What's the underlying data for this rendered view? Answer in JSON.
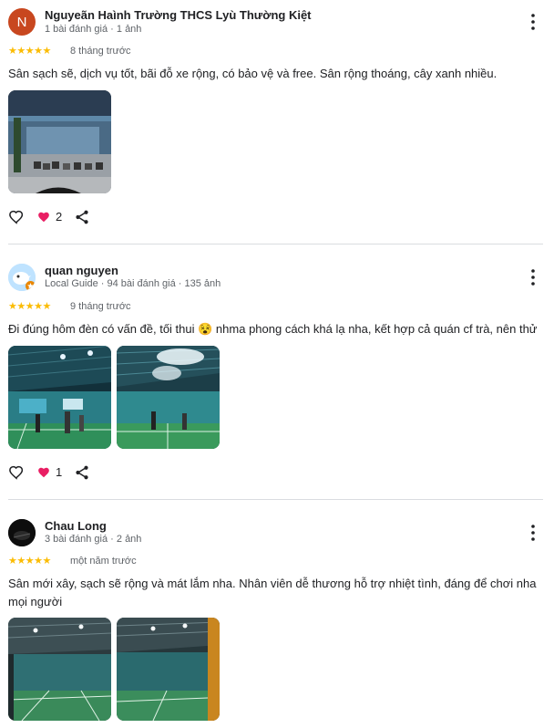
{
  "reviews": [
    {
      "author": "Nguyeãn Haình Trường THCS Lyù Thường Kiệt",
      "avatar_letter": "N",
      "meta": "1 bài đánh giá · 1 ảnh",
      "rating": "★★★★★",
      "time": "8 tháng trước",
      "text": "Sân sạch sẽ, dịch vụ tốt, bãi đỗ xe rộng, có bảo vệ và free. Sân rộng thoáng, cây xanh nhiều.",
      "like_count": "2"
    },
    {
      "author": "quan nguyen",
      "meta": "Local Guide · 94 bài đánh giá · 135 ảnh",
      "rating": "★★★★★",
      "time": "9 tháng trước",
      "text": "Đi đúng hôm đèn có vấn đề, tối thui 😵 nhma phong cách khá lạ nha, kết hợp cả quán cf trà, nên thử",
      "like_count": "1"
    },
    {
      "author": "Chau Long",
      "meta": "3 bài đánh giá · 2 ảnh",
      "rating": "★★★★★",
      "time": "một năm trước",
      "text": "Sân mới xây, sạch sẽ rộng và mát lắm nha. Nhân viên dễ thương hỗ trợ nhiệt tình, đáng để chơi nha mọi người"
    }
  ],
  "icons": {
    "more": "more-vert-icon",
    "like": "heart-outline-icon",
    "heart": "heart-filled-icon",
    "share": "share-icon"
  },
  "colors": {
    "star": "#fbbc04",
    "heart": "#e91e63",
    "meta_text": "#5f6368"
  }
}
